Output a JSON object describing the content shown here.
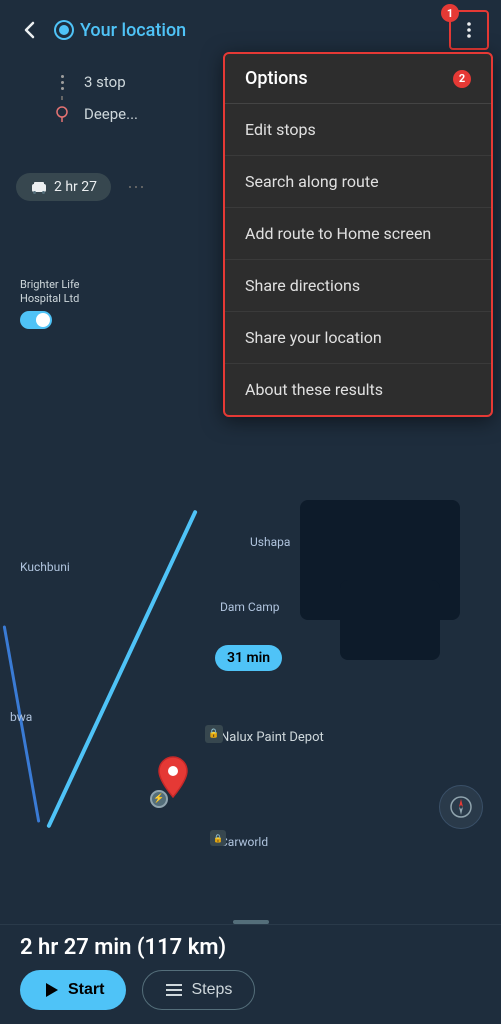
{
  "header": {
    "back_label": "←",
    "location_label": "Your location",
    "more_icon": "⋮",
    "badge_1": "1"
  },
  "route": {
    "stops": [
      {
        "icon": "dots",
        "label": "3 stop"
      },
      {
        "icon": "pin",
        "label": "Deepe..."
      }
    ],
    "duration": "2 hr 27",
    "transport_icon": "🚗"
  },
  "map": {
    "labels": {
      "kuchbuni": "Kuchbuni",
      "dam_camp": "Dam Camp",
      "ushapa": "Ushapa",
      "bwa": "bwa",
      "nalux": "Nalux Paint Depot",
      "carworld": "Carworld"
    },
    "hospital": "Brighter Life\nHospital Ltd",
    "min_badge": "31 min"
  },
  "dropdown": {
    "header": "Options",
    "badge_2": "2",
    "items": [
      {
        "label": "Edit stops"
      },
      {
        "label": "Search along route"
      },
      {
        "label": "Add route to Home screen"
      },
      {
        "label": "Share directions"
      },
      {
        "label": "Share your location"
      },
      {
        "label": "About these results"
      }
    ]
  },
  "bottom_bar": {
    "distance": "2 hr 27 min (117 km)",
    "start_label": "Start",
    "steps_label": "Steps"
  }
}
